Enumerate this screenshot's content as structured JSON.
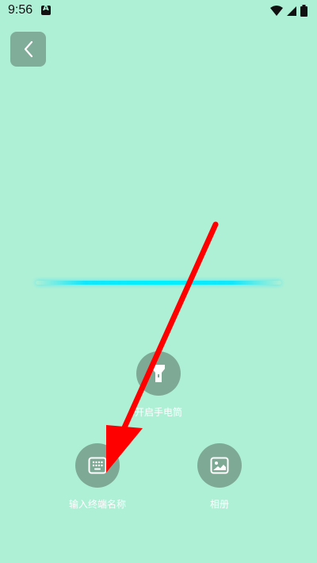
{
  "status_bar": {
    "time": "9:56",
    "icons": [
      "notification-a-icon",
      "wifi-icon",
      "signal-icon",
      "battery-icon"
    ]
  },
  "back_button": {
    "icon": "chevron-left-icon"
  },
  "actions": {
    "flashlight": {
      "label": "开启手电筒",
      "icon": "flashlight-icon"
    },
    "enter_terminal": {
      "label": "输入终端名称",
      "icon": "keypad-icon"
    },
    "album": {
      "label": "相册",
      "icon": "image-icon"
    }
  },
  "colors": {
    "background": "#aef0d6",
    "button": "#7eaa95",
    "scan_line": "#00f0ff",
    "annotation_arrow": "#ff0000"
  }
}
